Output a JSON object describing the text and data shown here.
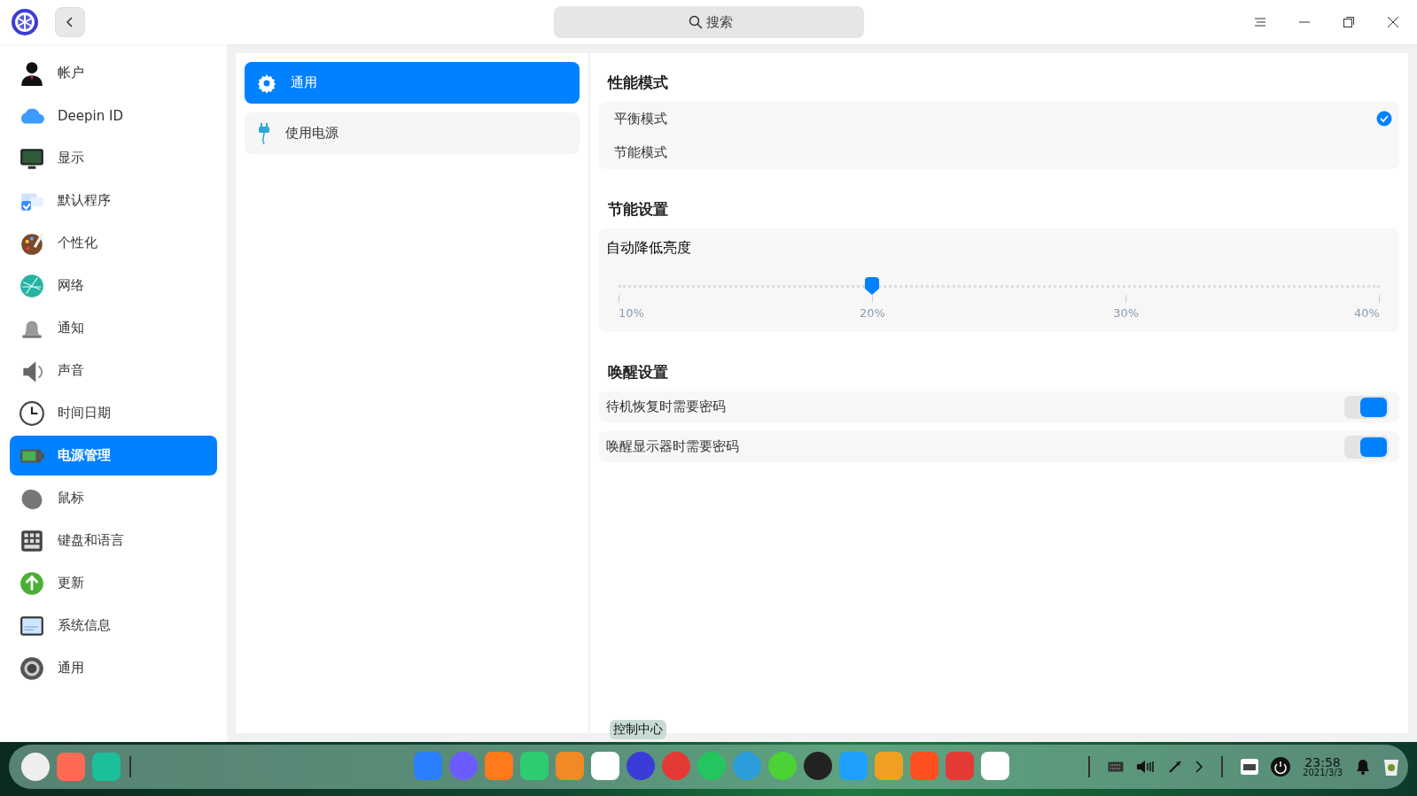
{
  "search": {
    "placeholder": "搜索"
  },
  "sidebar": {
    "items": [
      {
        "label": "帐户",
        "selected": false
      },
      {
        "label": "Deepin ID",
        "selected": false
      },
      {
        "label": "显示",
        "selected": false
      },
      {
        "label": "默认程序",
        "selected": false
      },
      {
        "label": "个性化",
        "selected": false
      },
      {
        "label": "网络",
        "selected": false
      },
      {
        "label": "通知",
        "selected": false
      },
      {
        "label": "声音",
        "selected": false
      },
      {
        "label": "时间日期",
        "selected": false
      },
      {
        "label": "电源管理",
        "selected": true
      },
      {
        "label": "鼠标",
        "selected": false
      },
      {
        "label": "键盘和语言",
        "selected": false
      },
      {
        "label": "更新",
        "selected": false
      },
      {
        "label": "系统信息",
        "selected": false
      },
      {
        "label": "通用",
        "selected": false
      }
    ]
  },
  "subnav": {
    "items": [
      {
        "label": "通用",
        "selected": true
      },
      {
        "label": "使用电源",
        "selected": false
      }
    ]
  },
  "performance": {
    "title": "性能模式",
    "options": [
      {
        "label": "平衡模式",
        "selected": true
      },
      {
        "label": "节能模式",
        "selected": false
      }
    ]
  },
  "power_saving": {
    "title": "节能设置",
    "slider": {
      "label": "自动降低亮度",
      "level": 0.3333,
      "ticks": [
        "10%",
        "20%",
        "30%",
        "40%"
      ]
    }
  },
  "wakeup": {
    "title": "唤醒设置",
    "toggles": [
      {
        "label": "待机恢复时需要密码",
        "on": true
      },
      {
        "label": "唤醒显示器时需要密码",
        "on": true
      }
    ]
  },
  "dock": {
    "tooltip": "控制中心",
    "clock": {
      "time": "23:58",
      "date": "2021/3/3"
    }
  }
}
